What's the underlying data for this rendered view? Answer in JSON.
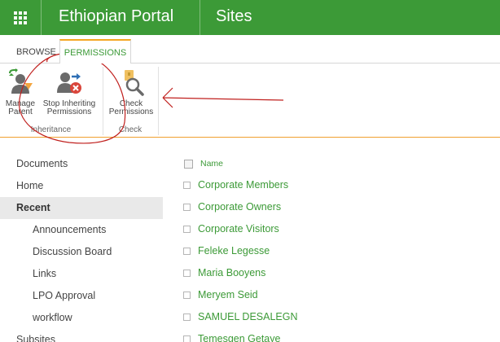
{
  "suitebar": {
    "site_title": "Ethiopian Portal",
    "page_title": "Sites",
    "bg_color": "#3c9a37"
  },
  "ribbon": {
    "tabs": [
      {
        "label": "BROWSE",
        "selected": false
      },
      {
        "label": "PERMISSIONS",
        "selected": true
      }
    ],
    "groups": [
      {
        "label": "Inheritance",
        "buttons": [
          {
            "line1": "Manage",
            "line2": "Parent",
            "icon": "manage-parent-icon"
          },
          {
            "line1": "Stop Inheriting",
            "line2": "Permissions",
            "icon": "stop-inheriting-icon"
          }
        ]
      },
      {
        "label": "Check",
        "buttons": [
          {
            "line1": "Check",
            "line2": "Permissions",
            "icon": "check-permissions-icon"
          }
        ]
      }
    ],
    "accent_color": "#f5a623"
  },
  "leftnav": {
    "items": [
      {
        "label": "Documents",
        "level": 1,
        "selected": false
      },
      {
        "label": "Home",
        "level": 1,
        "selected": false
      },
      {
        "label": "Recent",
        "level": 1,
        "selected": true
      },
      {
        "label": "Announcements",
        "level": 2,
        "selected": false
      },
      {
        "label": "Discussion Board",
        "level": 2,
        "selected": false
      },
      {
        "label": "Links",
        "level": 2,
        "selected": false
      },
      {
        "label": "LPO Approval",
        "level": 2,
        "selected": false
      },
      {
        "label": "workflow",
        "level": 2,
        "selected": false
      },
      {
        "label": "Subsites",
        "level": 1,
        "selected": false
      }
    ]
  },
  "list": {
    "column_name": "Name",
    "rows": [
      "Corporate Members",
      "Corporate Owners",
      "Corporate Visitors",
      "Feleke Legesse",
      "Maria Booyens",
      "Meryem Seid",
      "SAMUEL DESALEGN",
      "Temesgen Getaye"
    ],
    "link_color": "#3c9a37"
  },
  "annotation_color": "#c0201e"
}
